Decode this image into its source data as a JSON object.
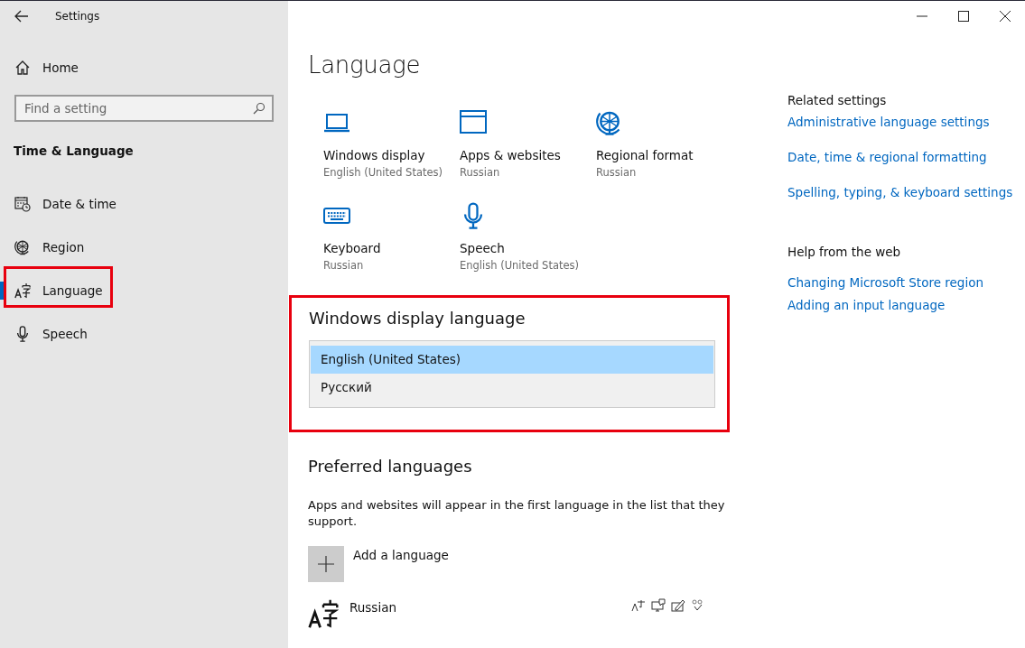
{
  "window": {
    "title": "Settings"
  },
  "sidebar": {
    "home": "Home",
    "search": {
      "placeholder": "Find a setting"
    },
    "section": "Time & Language",
    "items": [
      {
        "label": "Date & time",
        "selected": false,
        "annotated": false
      },
      {
        "label": "Region",
        "selected": false,
        "annotated": false
      },
      {
        "label": "Language",
        "selected": true,
        "annotated": true
      },
      {
        "label": "Speech",
        "selected": false,
        "annotated": false
      }
    ]
  },
  "page_title": "Language",
  "tiles": [
    {
      "label": "Windows display",
      "value": "English (United States)"
    },
    {
      "label": "Apps & websites",
      "value": "Russian"
    },
    {
      "label": "Regional format",
      "value": "Russian"
    },
    {
      "label": "Keyboard",
      "value": "Russian"
    },
    {
      "label": "Speech",
      "value": "English (United States)"
    }
  ],
  "display_language": {
    "heading": "Windows display language",
    "annotated": true,
    "options": [
      {
        "label": "English (United States)",
        "selected": true
      },
      {
        "label": "Русский",
        "selected": false
      }
    ]
  },
  "preferred": {
    "heading": "Preferred languages",
    "description": "Apps and websites will appear in the first language in the list that they support.",
    "add_label": "Add a language",
    "languages": [
      {
        "name": "Russian"
      }
    ]
  },
  "related": {
    "heading": "Related settings",
    "links": [
      "Administrative language settings",
      "Date, time & regional formatting",
      "Spelling, typing, & keyboard settings"
    ]
  },
  "help": {
    "heading": "Help from the web",
    "links": [
      "Changing Microsoft Store region",
      "Adding an input language"
    ]
  }
}
